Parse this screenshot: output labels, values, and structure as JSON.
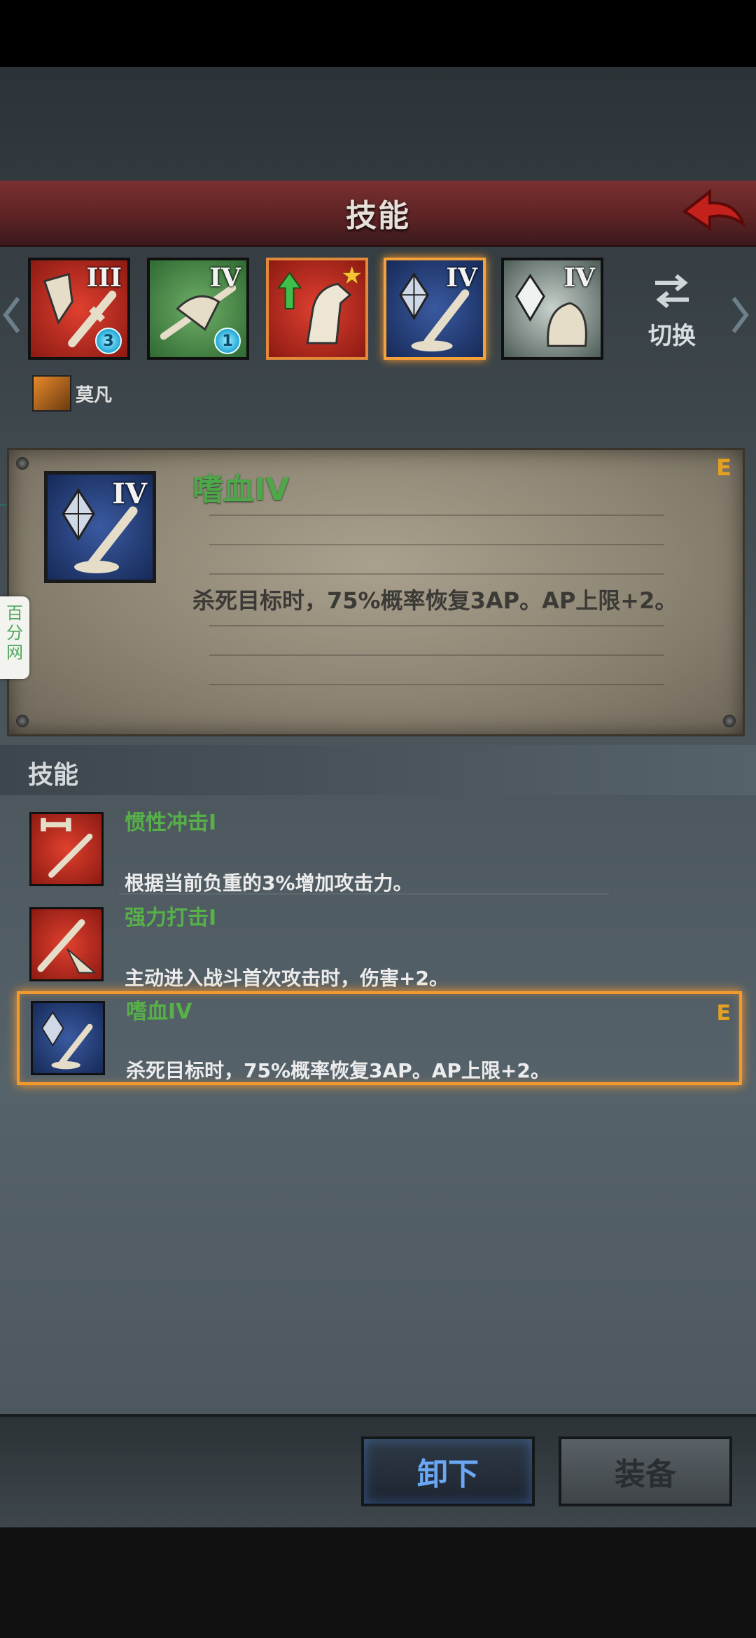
{
  "header": {
    "title": "技能"
  },
  "tabs": [
    {
      "numeral": "III",
      "badge": "3"
    },
    {
      "numeral": "IV",
      "badge": "1"
    },
    {
      "numeral": "",
      "badge": ""
    },
    {
      "numeral": "IV",
      "badge": ""
    },
    {
      "numeral": "IV",
      "badge": ""
    }
  ],
  "switch": {
    "label": "切换"
  },
  "hero": {
    "name": "莫凡"
  },
  "detail": {
    "numeral": "IV",
    "title": "嗜血IV",
    "grade": "E",
    "description": "杀死目标时，75%概率恢复3AP。AP上限+2。"
  },
  "skills_section": {
    "title": "技能"
  },
  "skills": [
    {
      "name": "惯性冲击I",
      "description": "根据当前负重的3%增加攻击力。",
      "grade": ""
    },
    {
      "name": "强力打击I",
      "description": "主动进入战斗首次攻击时，伤害+2。",
      "grade": ""
    },
    {
      "name": "嗜血IV",
      "description": "杀死目标时，75%概率恢复3AP。AP上限+2。",
      "grade": "E"
    }
  ],
  "buttons": {
    "unequip": "卸下",
    "equip": "装备"
  },
  "watermark": {
    "text": "百分网"
  },
  "colors": {
    "accent_orange": "#f39a2e",
    "skill_green": "#57b048",
    "header_red": "#7a3030"
  }
}
